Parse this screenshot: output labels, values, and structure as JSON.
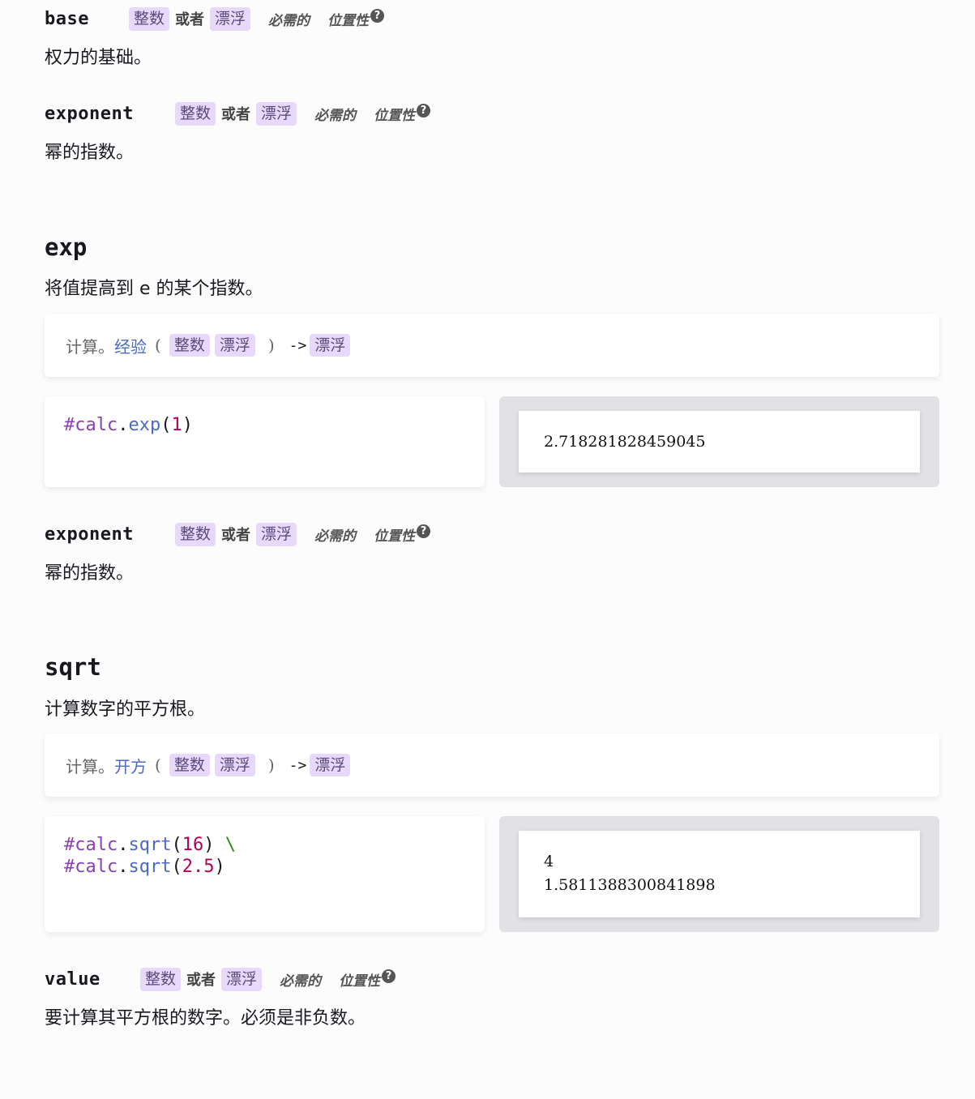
{
  "labels": {
    "type_int": "整数",
    "type_float": "漂浮",
    "or": "或者",
    "required": "必需的",
    "positional": "位置性"
  },
  "pow_params": [
    {
      "name": "base",
      "description": "权力的基础。"
    },
    {
      "name": "exponent",
      "description": "幂的指数。"
    }
  ],
  "exp": {
    "title": "exp",
    "description": "将值提高到 e 的某个指数。",
    "signature": {
      "prefix": "计算。",
      "fn": "经验",
      "arrow": "->"
    },
    "code": {
      "hash": "#",
      "module": "calc",
      "dot": ".",
      "fn": "exp",
      "open": "(",
      "arg": "1",
      "close": ")"
    },
    "output": [
      "2.718281828459045"
    ],
    "param": {
      "name": "exponent",
      "description": "幂的指数。"
    }
  },
  "sqrt": {
    "title": "sqrt",
    "description": "计算数字的平方根。",
    "signature": {
      "prefix": "计算。",
      "fn": "开方",
      "arrow": "->"
    },
    "code": [
      {
        "hash": "#",
        "module": "calc",
        "dot": ".",
        "fn": "sqrt",
        "open": "(",
        "arg": "16",
        "close": ")",
        "tail": " \\"
      },
      {
        "hash": "#",
        "module": "calc",
        "dot": ".",
        "fn": "sqrt",
        "open": "(",
        "arg": "2.5",
        "close": ")",
        "tail": ""
      }
    ],
    "output": [
      "4",
      "1.5811388300841898"
    ],
    "param": {
      "name": "value",
      "description": "要计算其平方根的数字。必须是非负数。"
    }
  }
}
